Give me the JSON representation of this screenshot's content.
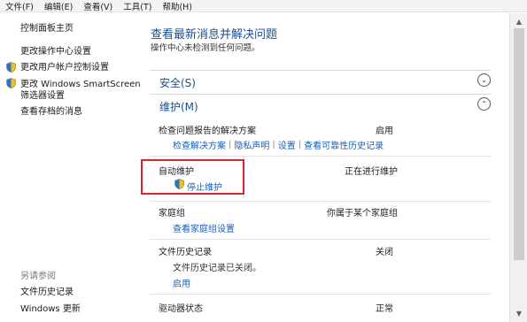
{
  "menu": [
    "文件(F)",
    "编辑(E)",
    "查看(V)",
    "工具(T)",
    "帮助(H)"
  ],
  "sidebar": {
    "home": "控制面板主页",
    "links": [
      {
        "label": "更改操作中心设置",
        "shield": false
      },
      {
        "label": "更改用户帐户控制设置",
        "shield": true
      },
      {
        "label": "更改 Windows SmartScreen",
        "shield": true
      },
      {
        "label": "筛选器设置",
        "shield": false
      },
      {
        "label": "查看存档的消息",
        "shield": false
      }
    ],
    "see_also_heading": "另请参阅",
    "see_also": [
      "文件历史记录",
      "Windows 更新"
    ]
  },
  "main": {
    "title": "查看最新消息并解决问题",
    "subtitle": "操作中心未检测到任何问题。",
    "sections": [
      {
        "label": "安全(S)",
        "state": "collapsed"
      },
      {
        "label": "维护(M)",
        "state": "expanded"
      }
    ],
    "maintenance": {
      "problem_reports": {
        "title": "检查问题报告的解决方案",
        "status": "启用",
        "links": [
          "检查解决方案",
          "隐私声明",
          "设置",
          "查看可靠性历史记录"
        ]
      },
      "auto_maintenance": {
        "title": "自动维护",
        "status": "正在进行维护",
        "action": "停止维护"
      },
      "homegroup": {
        "title": "家庭组",
        "status": "你属于某个家庭组",
        "link": "查看家庭组设置"
      },
      "file_history": {
        "title": "文件历史记录",
        "status": "关闭",
        "note": "文件历史记录已关闭。",
        "link": "启用"
      },
      "drive_status": {
        "title": "驱动器状态",
        "status": "正常"
      }
    }
  },
  "colors": {
    "accent_title": "#1d4f91",
    "link": "#1a5fb4",
    "highlight": "#d8262a"
  }
}
